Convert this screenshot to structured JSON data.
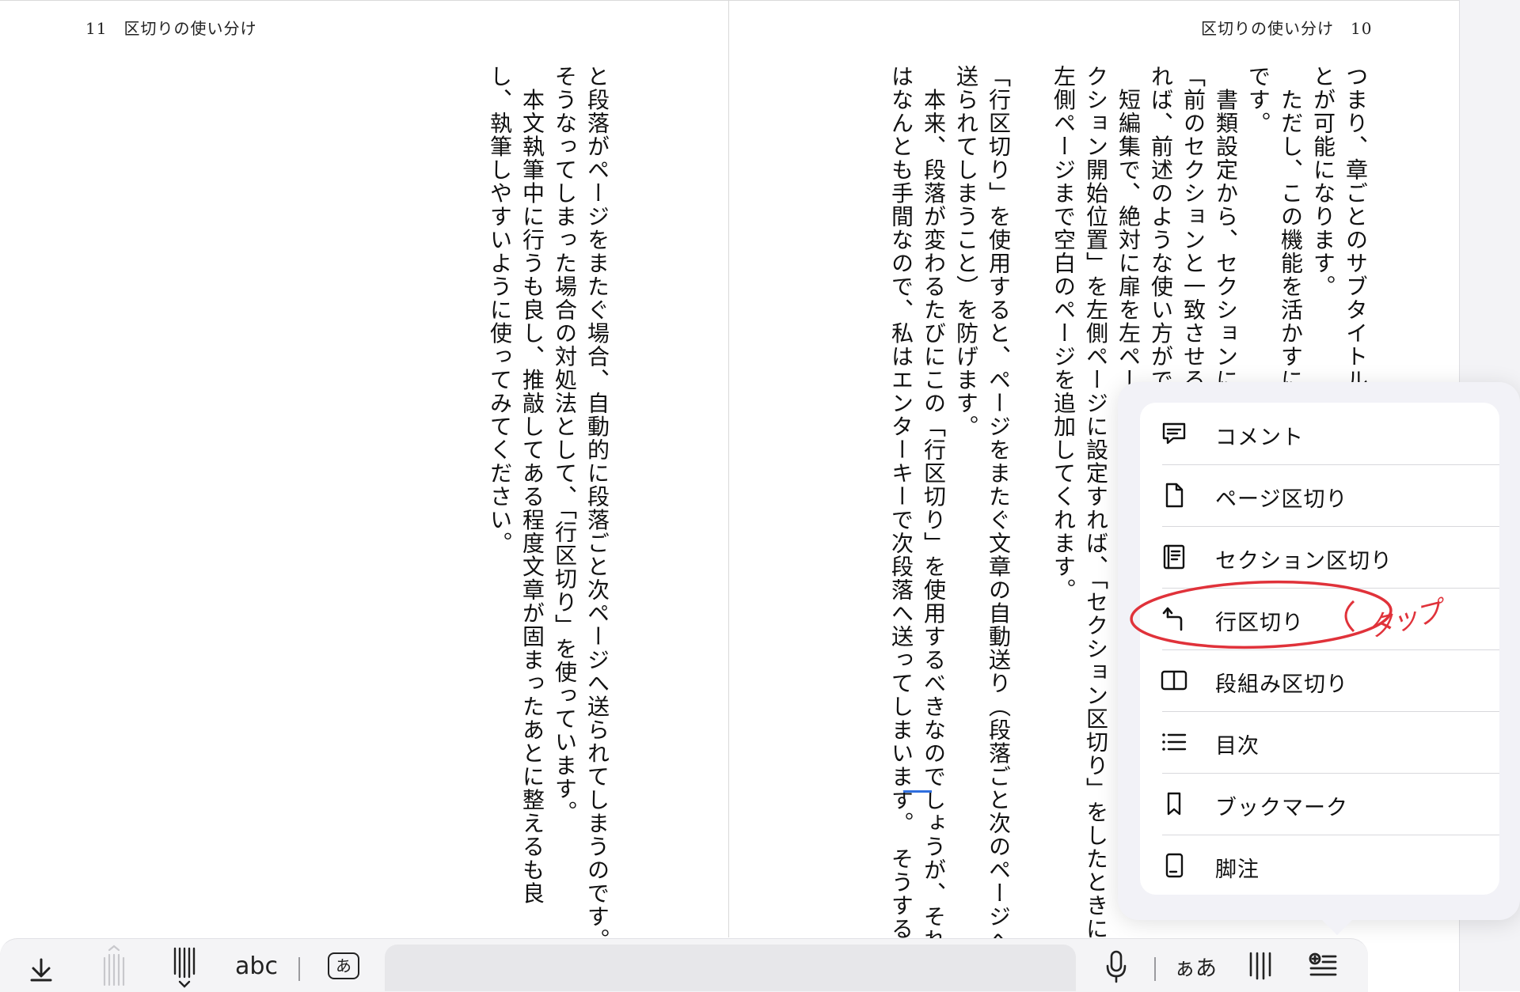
{
  "pages": {
    "left": {
      "header": "11　区切りの使い分け",
      "columns": [
        "と段落がページをまたぐ場合、自動的に段落ごと次ページへ送られてしまうのです。",
        "そうなってしまった場合の対処法として、「行区切り」を使っています。",
        "　本文執筆中に行うも良し、推敲してある程度文章が固まったあとに整えるも良",
        "し、執筆しやすいように使ってみてください。"
      ]
    },
    "right": {
      "header": "区切りの使い分け　10",
      "columns": [
        "つまり、章ごとのサブタイトル、",
        "とが可能になります。",
        "　ただし、この機能を活かすには",
        "です。",
        "　書類設定から、セクションに",
        "「前のセクションと一致させる",
        "れば、前述のような使い方がでい",
        "　短編集で、絶対に扉を左ペー",
        "クション開始位置」を左側ページに設定すれば、「セクション区切り」をしたときに、",
        "左側ページまで空白のページを追加してくれます。",
        "",
        "「行区切り」を使用すると、ページをまたぐ文章の自動送り（段落ごと次のページへ",
        "送られてしまうこと）を防げます。",
        "　本来、段落が変わるたびにこの「行区切り」を使用するべきなのでしょうが、それ",
        "はなんとも手間なので、私はエンターキーで次段落へ送ってしまいます。　そうする"
      ]
    }
  },
  "insert_menu": {
    "items": [
      {
        "label": "コメント",
        "icon": "comment-icon"
      },
      {
        "label": "ページ区切り",
        "icon": "page-icon"
      },
      {
        "label": "セクション区切り",
        "icon": "section-icon"
      },
      {
        "label": "行区切り",
        "icon": "line-break-icon"
      },
      {
        "label": "段組み区切り",
        "icon": "columns-icon"
      },
      {
        "label": "目次",
        "icon": "list-icon"
      },
      {
        "label": "ブックマーク",
        "icon": "bookmark-icon"
      },
      {
        "label": "脚注",
        "icon": "footnote-icon"
      }
    ],
    "highlighted_index": 3
  },
  "annotation": {
    "text": "タップ",
    "color": "#e0323a"
  },
  "keyboard_toolbar": {
    "abc_label": "abc",
    "kana_key_label": "あ",
    "font_size_label": "ぁあ",
    "icons": [
      "dismiss-keyboard-icon",
      "tategaki-up-icon",
      "tategaki-down-icon",
      "microphone-icon",
      "vertical-lines-icon",
      "insert-icon"
    ]
  },
  "colors": {
    "cursor": "#2f6fe0",
    "annotation": "#e0323a",
    "popup_bg": "#f2f2f7"
  }
}
